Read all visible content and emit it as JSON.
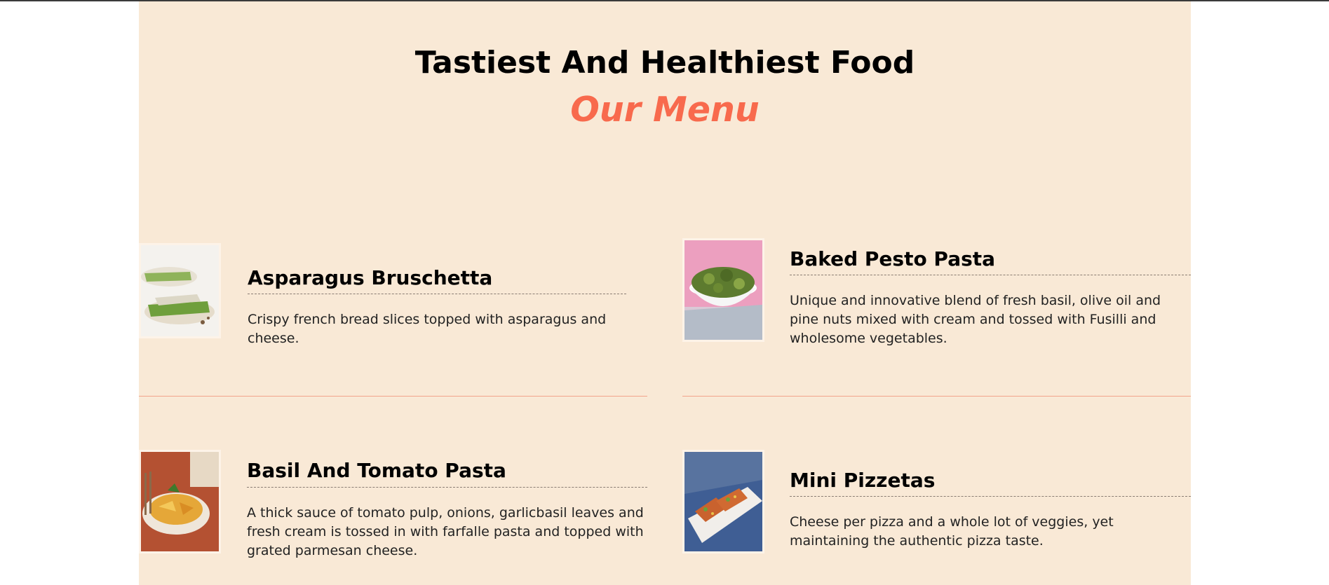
{
  "header": {
    "title": "Tastiest And Healthiest Food",
    "subtitle": "Our Menu"
  },
  "colors": {
    "panel_background": "#f9e9d6",
    "accent": "#f86a4d",
    "divider": "#f2a48c"
  },
  "menu": {
    "items": [
      {
        "name": "Asparagus Bruschetta",
        "description": "Crispy french bread slices topped with asparagus and cheese.",
        "image": "asparagus-bruschetta-photo"
      },
      {
        "name": "Baked Pesto Pasta",
        "description": "Unique and innovative blend of fresh basil, olive oil and pine nuts mixed with cream and tossed with Fusilli and wholesome vegetables.",
        "image": "baked-pesto-pasta-photo"
      },
      {
        "name": "Basil And Tomato Pasta",
        "description": "A thick sauce of tomato pulp, onions, garlicbasil leaves and fresh cream is tossed in with farfalle pasta and topped with grated parmesan cheese.",
        "image": "basil-tomato-pasta-photo"
      },
      {
        "name": "Mini Pizzetas",
        "description": "Cheese per pizza and a whole lot of veggies, yet maintaining the authentic pizza taste.",
        "image": "mini-pizzetas-photo"
      }
    ]
  }
}
